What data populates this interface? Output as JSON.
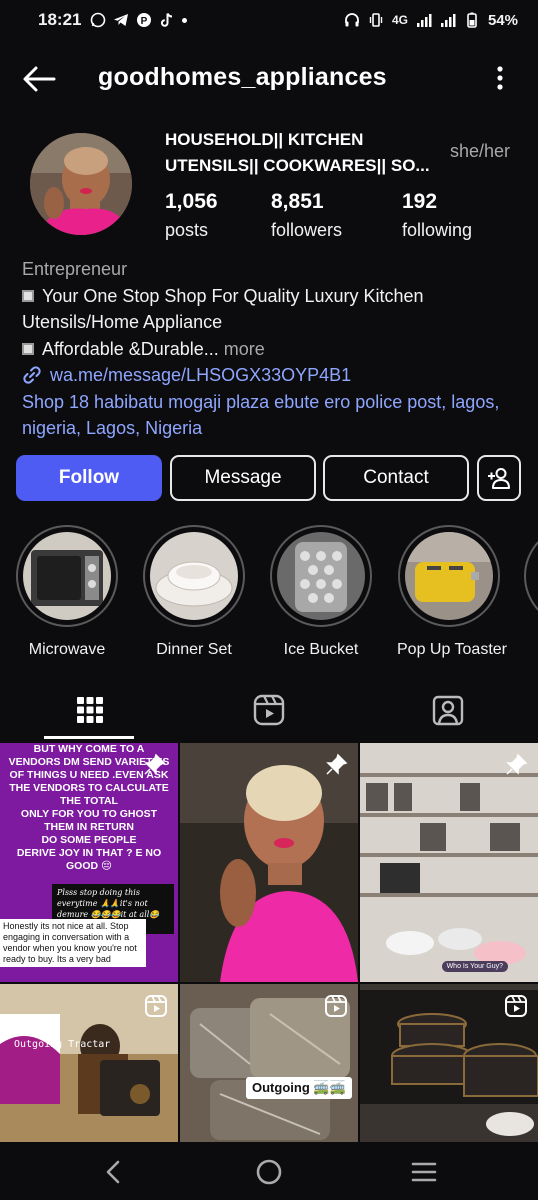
{
  "status_bar": {
    "time": "18:21",
    "network": "4G",
    "battery": "54%"
  },
  "header": {
    "username": "goodhomes_appliances"
  },
  "profile": {
    "display_name": "HOUSEHOLD|| KITCHEN\nUTENSILS|| COOKWARES|| SO...",
    "pronouns": "she/her",
    "stats": [
      {
        "value": "1,056",
        "label": "posts"
      },
      {
        "value": "8,851",
        "label": "followers"
      },
      {
        "value": "192",
        "label": "following"
      }
    ]
  },
  "bio": {
    "category": "Entrepreneur",
    "line1": "Your One Stop Shop For Quality Luxury Kitchen",
    "line2": "Utensils/Home Appliance",
    "line3": "Affordable &Durable...",
    "more": " more",
    "link": "wa.me/message/LHSOGX33OYP4B1",
    "address": "Shop 18 habibatu mogaji plaza ebute ero police post, lagos, nigeria, Lagos, Nigeria"
  },
  "buttons": {
    "follow": "Follow",
    "message": "Message",
    "contact": "Contact"
  },
  "highlights": [
    {
      "label": "Microwave"
    },
    {
      "label": "Dinner Set"
    },
    {
      "label": "Ice Bucket"
    },
    {
      "label": "Pop Up Toaster"
    }
  ],
  "posts": {
    "post1_text": "BUT WHY COME TO A\nVENDORS DM SEND VARIETIES\nOF THINGS U NEED .EVEN ASK\nTHE VENDORS TO CALCULATE\nTHE TOTAL\nONLY FOR YOU TO GHOST\nTHEM IN RETURN\nDO SOME PEOPLE\nDERIVE JOY IN THAT ? E NO\nGOOD 😔",
    "post1_sticker_a": "Plsss stop doing this everytime 🙏🙏it's not demure 😂😂😂it at all😂😂😂",
    "post1_sticker_b": "Honestly its not nice at all. Stop engaging in conversation with a vendor when you know you're not ready to buy. Its a very bad",
    "post3_caption": "Who Is Your Guy?",
    "post4_caption": "Outgoing Tractar",
    "post5_tag": "Outgoing 🚎🚎"
  },
  "colors": {
    "accent": "#4f5cf4",
    "link": "#8fa6ff",
    "background": "#0c0c0e"
  }
}
